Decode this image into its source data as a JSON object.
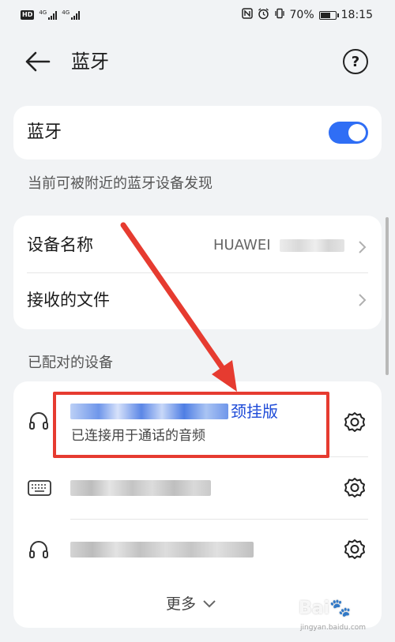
{
  "status_bar": {
    "hd_badge": "HD",
    "network_label": "4G",
    "battery_percent_text": "70%",
    "battery_level": 0.7,
    "time": "18:15"
  },
  "header": {
    "title": "蓝牙",
    "help_label": "?"
  },
  "bluetooth": {
    "label": "蓝牙",
    "enabled": true,
    "visibility_hint": "当前可被附近的蓝牙设备发现"
  },
  "device_info": {
    "name_label": "设备名称",
    "name_value": "HUAWEI",
    "received_files_label": "接收的文件"
  },
  "paired": {
    "section_label": "已配对的设备",
    "devices": [
      {
        "icon": "headphones-icon",
        "name_suffix": "颈挂版",
        "status": "已连接用于通话的音频"
      },
      {
        "icon": "keyboard-icon",
        "name_suffix": "",
        "status": ""
      },
      {
        "icon": "headphones-icon",
        "name_suffix": "",
        "status": ""
      }
    ],
    "more_label": "更多"
  },
  "watermark": {
    "text": "Bai",
    "sub": "jingyan.baidu.com"
  },
  "colors": {
    "accent": "#2f6ef5",
    "annotation_red": "#e63b30",
    "device_name_blue": "#1e4bd8"
  }
}
